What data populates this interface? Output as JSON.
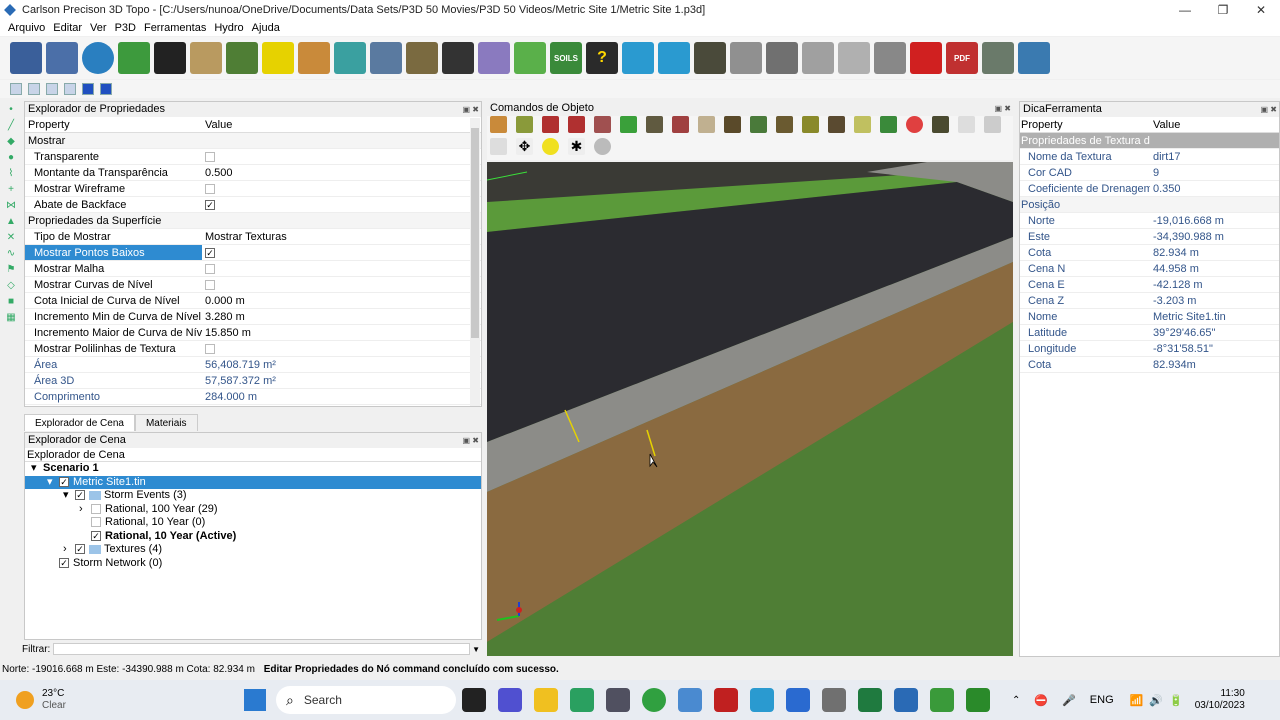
{
  "window": {
    "title": "Carlson Precison 3D Topo - [C:/Users/nunoa/OneDrive/Documents/Data Sets/P3D 50 Movies/P3D 50 Videos/Metric Site 1/Metric Site 1.p3d]",
    "minimize": "—",
    "maximize": "❐",
    "close": "✕"
  },
  "menu": [
    "Arquivo",
    "Editar",
    "Ver",
    "P3D",
    "Ferramentas",
    "Hydro",
    "Ajuda"
  ],
  "toolbar": {
    "soils_label": "SOILS",
    "help_label": "?",
    "pdf_label": "PDF"
  },
  "property_explorer": {
    "title": "Explorador de Propriedades",
    "col_property": "Property",
    "col_value": "Value",
    "rows": [
      {
        "p": "Mostrar",
        "v": "",
        "cat": true
      },
      {
        "p": "Transparente",
        "v": "",
        "cb": false
      },
      {
        "p": "Montante da Transparência",
        "v": "0.500"
      },
      {
        "p": "Mostrar Wireframe",
        "v": "",
        "cb": false
      },
      {
        "p": "Abate de Backface",
        "v": "",
        "cb": true
      },
      {
        "p": "Propriedades da Superfície",
        "v": "",
        "cat": true
      },
      {
        "p": "Tipo de Mostrar",
        "v": "Mostrar Texturas"
      },
      {
        "p": "Mostrar Pontos Baixos",
        "v": "",
        "cb": true,
        "sel": true
      },
      {
        "p": "Mostrar Malha",
        "v": "",
        "cb": false
      },
      {
        "p": "Mostrar Curvas de Nível",
        "v": "",
        "cb": false
      },
      {
        "p": "Cota Inicial de Curva de Nível",
        "v": "0.000 m"
      },
      {
        "p": "Incremento Min de Curva de Nível",
        "v": "3.280 m"
      },
      {
        "p": "Incremento Maior de Curva de Nível",
        "v": "15.850 m"
      },
      {
        "p": "Mostrar Polilinhas de Textura",
        "v": "",
        "cb": false
      },
      {
        "p": "Área",
        "v": "56,408.719 m²",
        "ro": true
      },
      {
        "p": "Área 3D",
        "v": "57,587.372 m²",
        "ro": true
      },
      {
        "p": "Comprimento",
        "v": "284.000 m",
        "ro": true
      }
    ]
  },
  "scene_tabs": [
    "Explorador de Cena",
    "Materiais"
  ],
  "scene_explorer": {
    "title": "Explorador de Cena",
    "subtitle": "Explorador de Cena",
    "nodes": [
      {
        "label": "Scenario 1",
        "indent": 0,
        "bold": true,
        "exp": "▾"
      },
      {
        "label": "Metric Site1.tin",
        "indent": 1,
        "exp": "▾",
        "cb": true,
        "sel": true
      },
      {
        "label": "Storm Events (3)",
        "indent": 2,
        "exp": "▾",
        "cb": true,
        "folder": true
      },
      {
        "label": "Rational, 100 Year (29)",
        "indent": 3,
        "exp": "›",
        "cb": false
      },
      {
        "label": "Rational, 10 Year (0)",
        "indent": 3,
        "exp": "",
        "cb": false
      },
      {
        "label": "Rational, 10 Year (Active)",
        "indent": 3,
        "exp": "",
        "cb": true,
        "bold": true
      },
      {
        "label": "Textures (4)",
        "indent": 2,
        "exp": "›",
        "cb": true,
        "folder": true
      },
      {
        "label": "Storm Network (0)",
        "indent": 1,
        "exp": "",
        "cb": true
      }
    ]
  },
  "filter_label": "Filtrar:",
  "object_commands": {
    "title": "Comandos de Objeto"
  },
  "tooltip_panel": {
    "title": "DicaFerramenta",
    "col_property": "Property",
    "col_value": "Value",
    "rows": [
      {
        "p": "Propriedades de Textura da Superfície",
        "v": "",
        "cat": true,
        "hl": true
      },
      {
        "p": "Nome da Textura",
        "v": "dirt17"
      },
      {
        "p": "Cor CAD",
        "v": "9"
      },
      {
        "p": "Coeficiente de Drenagem",
        "v": "0.350"
      },
      {
        "p": "Posição",
        "v": "",
        "cat": true
      },
      {
        "p": "Norte",
        "v": "-19,016.668 m"
      },
      {
        "p": "Este",
        "v": "-34,390.988 m"
      },
      {
        "p": "Cota",
        "v": "82.934 m"
      },
      {
        "p": "Cena N",
        "v": "44.958 m"
      },
      {
        "p": "Cena E",
        "v": "-42.128 m"
      },
      {
        "p": "Cena Z",
        "v": "-3.203 m"
      },
      {
        "p": "Nome",
        "v": "Metric Site1.tin"
      },
      {
        "p": "Latitude",
        "v": "39°29'46.65\""
      },
      {
        "p": "Longitude",
        "v": "-8°31'58.51\""
      },
      {
        "p": "Cota",
        "v": "82.934m"
      }
    ]
  },
  "status": {
    "coords": "Norte: -19016.668 m Este: -34390.988 m Cota: 82.934 m",
    "message": "Editar Propriedades do Nó command concluído com sucesso."
  },
  "taskbar": {
    "temp": "23°C",
    "weather": "Clear",
    "search": "Search",
    "lang": "ENG",
    "time": "11:30",
    "date": "03/10/2023"
  },
  "colors": {
    "selection": "#2e8bd1",
    "grass": "#4f7e35",
    "road": "#2b2b30",
    "curb": "#8c8c88"
  }
}
